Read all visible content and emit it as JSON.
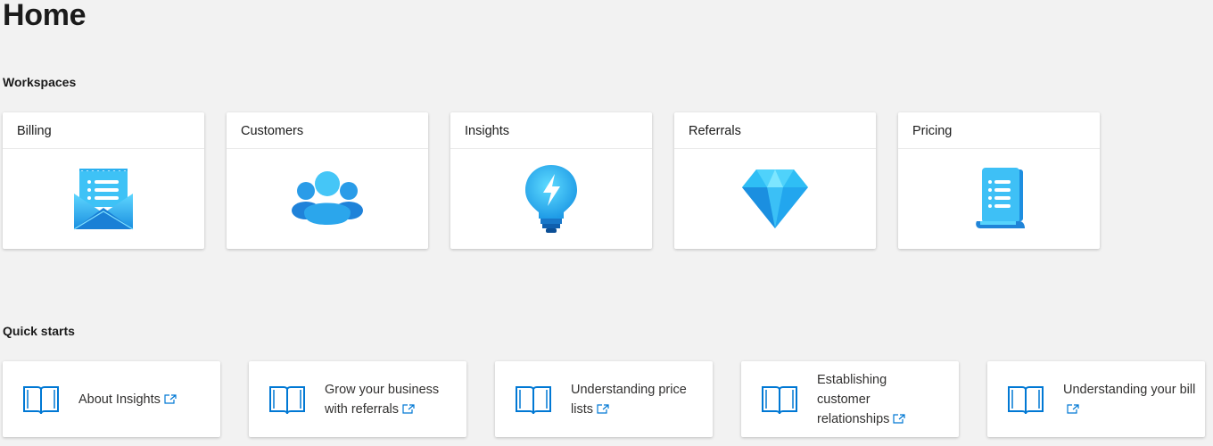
{
  "page": {
    "title": "Home"
  },
  "workspaces": {
    "heading": "Workspaces",
    "items": [
      {
        "label": "Billing",
        "icon": "billing-envelope-icon"
      },
      {
        "label": "Customers",
        "icon": "customers-people-icon"
      },
      {
        "label": "Insights",
        "icon": "insights-lightbulb-icon"
      },
      {
        "label": "Referrals",
        "icon": "referrals-diamond-icon"
      },
      {
        "label": "Pricing",
        "icon": "pricing-scroll-icon"
      }
    ]
  },
  "quickstarts": {
    "heading": "Quick starts",
    "items": [
      {
        "label": "About Insights",
        "icon": "book-icon"
      },
      {
        "label": "Grow your business with referrals",
        "icon": "book-icon"
      },
      {
        "label": "Understanding price lists",
        "icon": "book-icon"
      },
      {
        "label": "Establishing customer relationships",
        "icon": "book-icon"
      },
      {
        "label": "Understanding your bill",
        "icon": "book-icon"
      }
    ]
  },
  "colors": {
    "accent": "#0078d4",
    "icon_light": "#50e6ff",
    "icon_mid": "#29b5f0",
    "icon_dark": "#0a6ac6",
    "background": "#f2f2f2"
  }
}
